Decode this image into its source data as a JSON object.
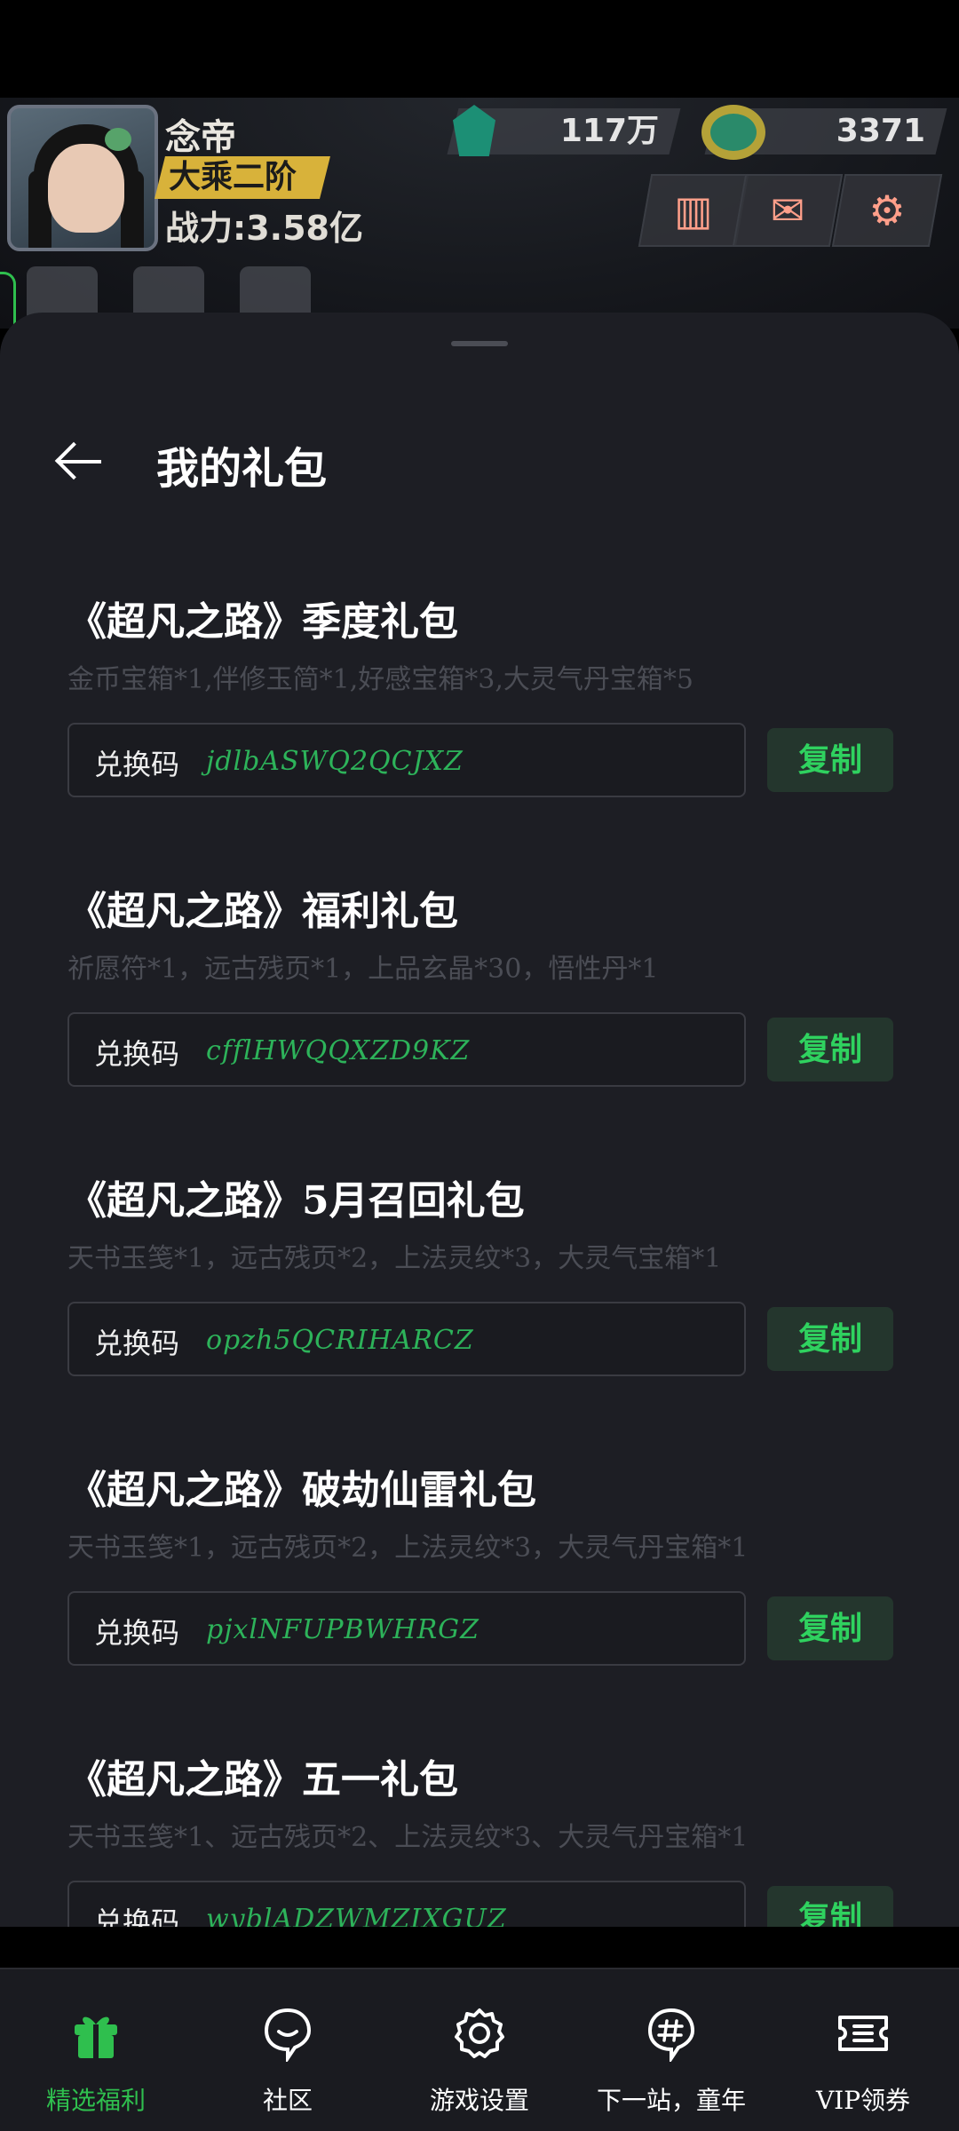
{
  "game_header": {
    "player_name": "念帝",
    "rank": "大乘二阶",
    "power": "战力:3.58亿",
    "gems": "117万",
    "coins": "3371",
    "icons": [
      "ranking-icon",
      "mail-icon",
      "settings-icon"
    ]
  },
  "sheet": {
    "title": "我的礼包",
    "code_label": "兑换码",
    "copy_label": "复制"
  },
  "gifts": [
    {
      "name": "《超凡之路》季度礼包",
      "desc": "金币宝箱*1,伴修玉简*1,好感宝箱*3,大灵气丹宝箱*5",
      "code": "jdlbASWQ2QCJXZ"
    },
    {
      "name": "《超凡之路》福利礼包",
      "desc": "祈愿符*1，远古残页*1，上品玄晶*30，悟性丹*1",
      "code": "cfflHWQQXZD9KZ"
    },
    {
      "name": "《超凡之路》5月召回礼包",
      "desc": "天书玉笺*1，远古残页*2，上法灵纹*3，大灵气宝箱*1",
      "code": "opzh5QCRIHARCZ"
    },
    {
      "name": "《超凡之路》破劫仙雷礼包",
      "desc": "天书玉笺*1，远古残页*2，上法灵纹*3，大灵气丹宝箱*1",
      "code": "pjxlNFUPBWHRGZ"
    },
    {
      "name": "《超凡之路》五一礼包",
      "desc": "天书玉笺*1、远古残页*2、上法灵纹*3、大灵气丹宝箱*1",
      "code": "wyblADZWMZIXGUZ"
    }
  ],
  "bottom_nav": [
    {
      "label": "精选福利",
      "icon": "gift-icon",
      "active": true
    },
    {
      "label": "社区",
      "icon": "chat-icon",
      "active": false
    },
    {
      "label": "游戏设置",
      "icon": "gear-icon",
      "active": false
    },
    {
      "label": "下一站，童年",
      "icon": "hashtag-icon",
      "active": false
    },
    {
      "label": "VIP领券",
      "icon": "ticket-icon",
      "active": false
    }
  ],
  "colors": {
    "accent_green": "#2fbf4e",
    "sheet_bg": "#1d1e24",
    "code_green": "#2db35a"
  }
}
